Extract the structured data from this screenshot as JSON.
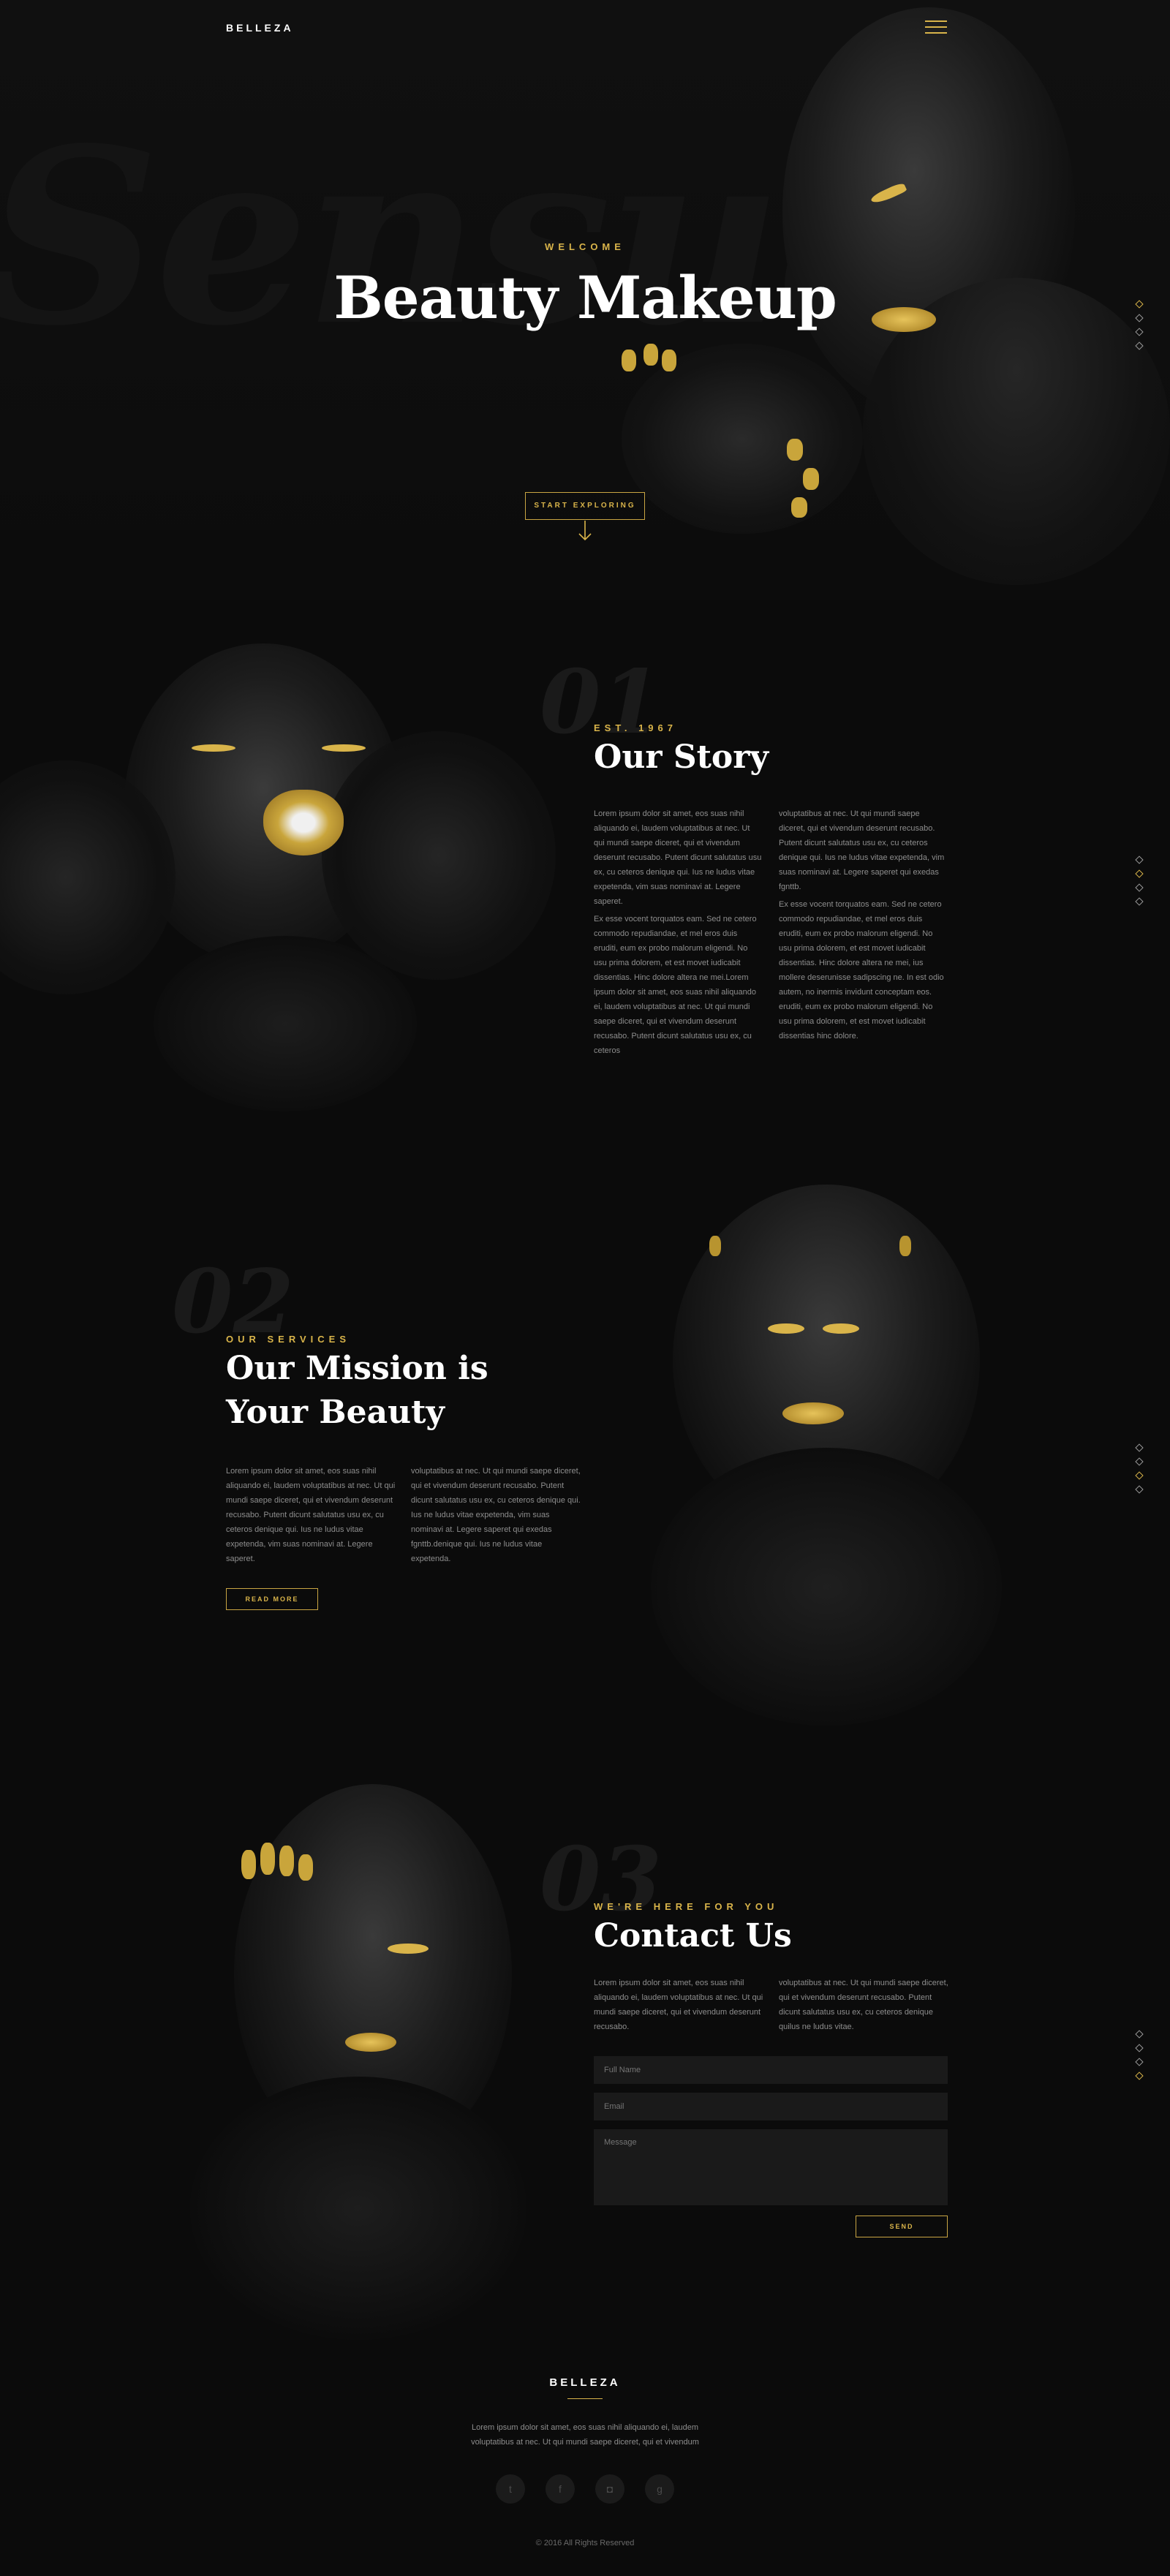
{
  "header": {
    "logo": "BELLEZA",
    "menu_icon": "hamburger-icon"
  },
  "hero": {
    "bg_script": "Sensual",
    "eyebrow": "WELCOME",
    "title": "Beauty Makeup",
    "cta_label": "START EXPLORING",
    "arrow_icon": "arrow-down-icon"
  },
  "story": {
    "number": "01",
    "eyebrow": "EST. 1967",
    "title": "Our Story",
    "col1_p1": "Lorem ipsum dolor sit amet, eos suas nihil aliquando ei, laudem voluptatibus at nec. Ut qui mundi saepe diceret, qui et vivendum deserunt recusabo. Putent dicunt salutatus usu ex, cu ceteros denique qui. Ius ne ludus vitae expetenda, vim suas nominavi at. Legere saperet.",
    "col1_p2": "Ex esse vocent torquatos eam. Sed ne cetero commodo repudiandae, et mel eros duis eruditi, eum ex probo malorum eligendi. No usu prima dolorem, et est movet iudicabit dissentias. Hinc dolore altera ne mei.Lorem ipsum dolor sit amet, eos suas nihil aliquando ei, laudem voluptatibus at nec. Ut qui mundi saepe diceret, qui et vivendum deserunt recusabo. Putent dicunt salutatus usu ex, cu ceteros",
    "col2_p1": "voluptatibus at nec. Ut qui mundi saepe diceret, qui et vivendum deserunt recusabo. Putent dicunt salutatus usu ex, cu ceteros denique qui. Ius ne ludus vitae expetenda, vim suas nominavi at. Legere saperet qui exedas fgnttb.",
    "col2_p2": "Ex esse vocent torquatos eam. Sed ne cetero commodo repudiandae, et mel eros duis eruditi, eum ex probo malorum eligendi. No usu prima dolorem, et est movet iudicabit dissentias. Hinc dolore altera ne mei, ius mollere deserunisse sadipscing ne. In est odio autem, no inermis invidunt conceptam eos. eruditi, eum ex probo malorum eligendi. No usu prima dolorem, et est movet iudicabit dissentias hinc dolore."
  },
  "services": {
    "number": "02",
    "eyebrow": "OUR SERVICES",
    "title_line1": "Our Mission is",
    "title_line2": "Your Beauty",
    "col1": "Lorem ipsum dolor sit amet, eos suas nihil aliquando ei, laudem voluptatibus at nec. Ut qui mundi saepe diceret, qui et vivendum deserunt recusabo. Putent dicunt salutatus usu ex, cu ceteros denique qui. Ius ne ludus vitae expetenda, vim suas nominavi at. Legere saperet.",
    "col2": "voluptatibus at nec. Ut qui mundi saepe diceret, qui et vivendum deserunt recusabo. Putent dicunt salutatus usu ex, cu ceteros denique qui. Ius ne ludus vitae expetenda, vim suas nominavi at. Legere saperet qui exedas fgnttb.denique qui. Ius ne ludus vitae expetenda.",
    "cta_label": "READ MORE"
  },
  "contact": {
    "number": "03",
    "eyebrow": "WE'RE HERE FOR YOU",
    "title": "Contact Us",
    "col1": "Lorem ipsum dolor sit amet, eos suas nihil aliquando ei, laudem voluptatibus at nec. Ut qui mundi saepe diceret, qui et vivendum deserunt recusabo.",
    "col2": "voluptatibus at nec. Ut qui mundi saepe diceret, qui et vivendum deserunt recusabo. Putent dicunt salutatus usu ex, cu ceteros denique quilus ne ludus vitae.",
    "name_placeholder": "Full Name",
    "email_placeholder": "Email",
    "message_placeholder": "Message",
    "send_label": "SEND"
  },
  "footer": {
    "logo": "BELLEZA",
    "text_line1": "Lorem ipsum dolor sit amet, eos suas nihil aliquando ei, laudem",
    "text_line2": "voluptatibus at nec. Ut qui mundi saepe diceret, qui et vivendum",
    "socials": [
      {
        "icon": "twitter-icon",
        "glyph": "t"
      },
      {
        "icon": "facebook-icon",
        "glyph": "f"
      },
      {
        "icon": "instagram-icon",
        "glyph": "◘"
      },
      {
        "icon": "google-plus-icon",
        "glyph": "g"
      }
    ],
    "copyright": "© 2016 All Rights Reserved"
  },
  "colors": {
    "accent": "#d9b44a",
    "background": "#0b0b0b",
    "muted_text": "#8d8d8d"
  }
}
